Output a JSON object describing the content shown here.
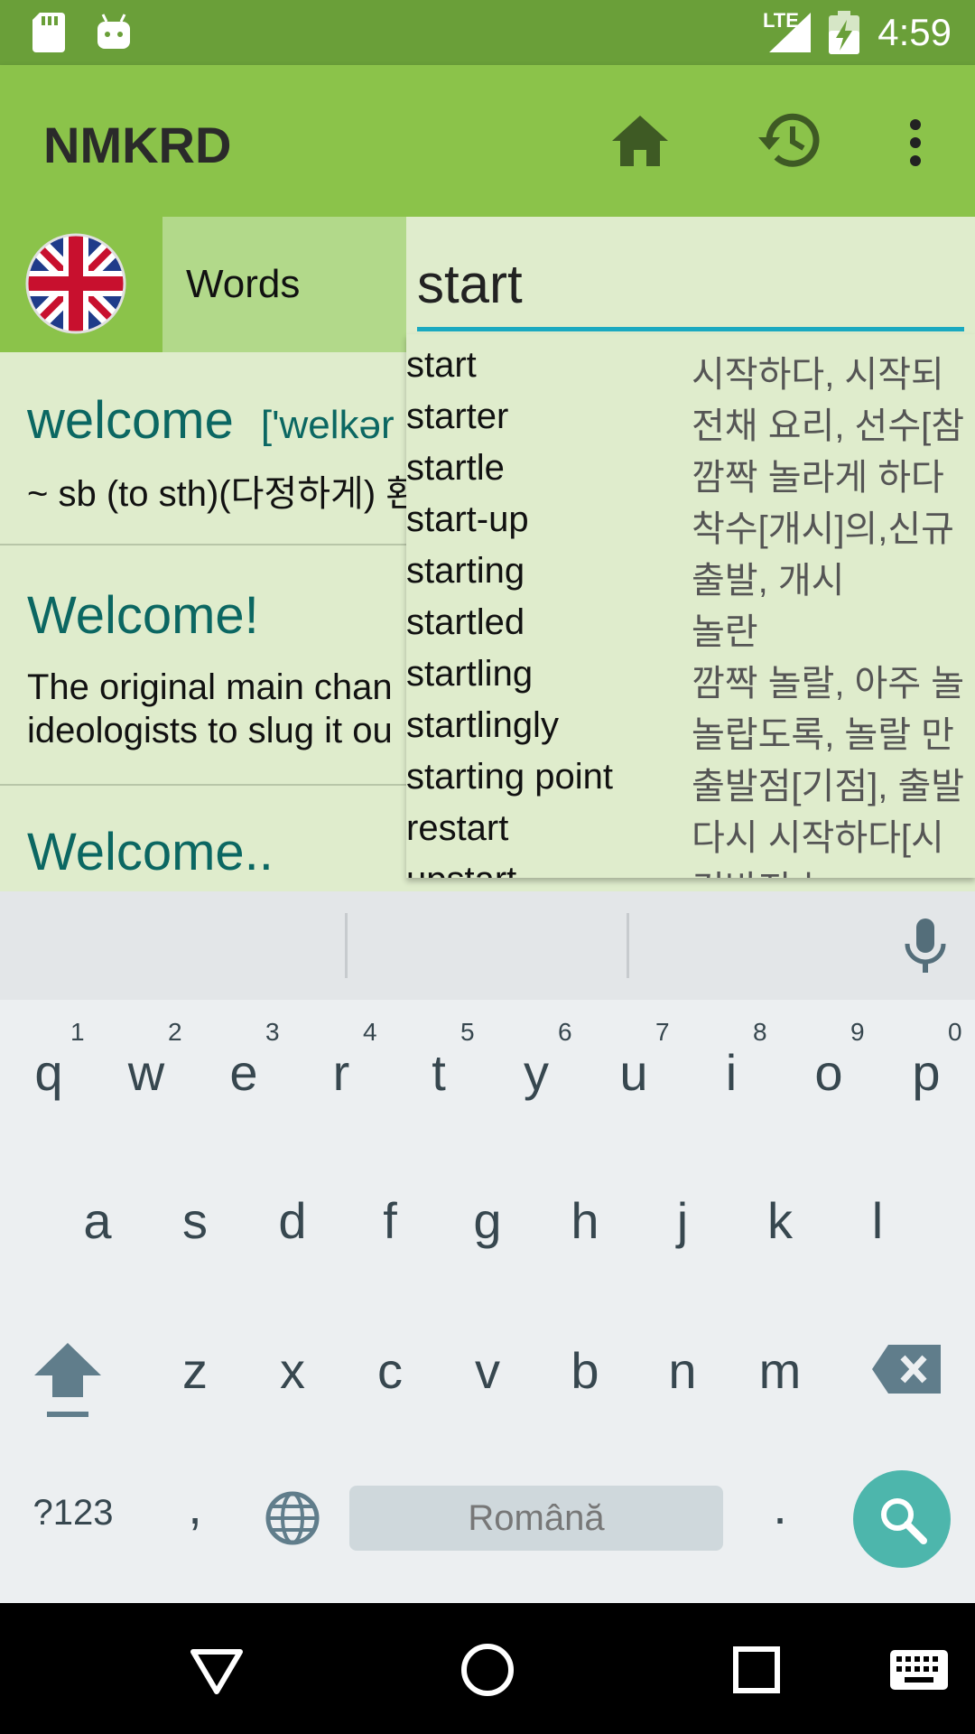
{
  "status_bar": {
    "time": "4:59",
    "network": "LTE"
  },
  "app_bar": {
    "title": "NMKRD",
    "icons": [
      "home-icon",
      "history-icon",
      "more-vert-icon"
    ]
  },
  "language": {
    "flag": "uk-flag",
    "mode_label": "Words"
  },
  "search": {
    "query": "start"
  },
  "results": [
    {
      "headword": "welcome",
      "pronunciation": "['welkər",
      "snippet": "~ sb (to sth)(다정하게) 환"
    },
    {
      "headword": "Welcome!",
      "snippet": "The original main chan",
      "snippet2": "ideologists to slug it ou"
    },
    {
      "headword": "Welcome..",
      "snippet": ""
    }
  ],
  "suggestions": [
    {
      "word": "start",
      "translation": "시작하다, 시작되"
    },
    {
      "word": "starter",
      "translation": "전채 요리, 선수[참"
    },
    {
      "word": "startle",
      "translation": "깜짝 놀라게 하다"
    },
    {
      "word": "start-up",
      "translation": "착수[개시]의,신규"
    },
    {
      "word": "starting",
      "translation": "출발, 개시"
    },
    {
      "word": "startled",
      "translation": "놀란"
    },
    {
      "word": "startling",
      "translation": "깜짝 놀랄, 아주 놀"
    },
    {
      "word": "startlingly",
      "translation": "놀랍도록, 놀랄 만"
    },
    {
      "word": "starting point",
      "translation": "출발점[기점], 출발"
    },
    {
      "word": "restart",
      "translation": "다시 시작하다[시"
    },
    {
      "word": "upstart",
      "translation": "건방진 놈"
    }
  ],
  "keyboard": {
    "row1": [
      "q",
      "w",
      "e",
      "r",
      "t",
      "y",
      "u",
      "i",
      "o",
      "p"
    ],
    "row1_hints": [
      "1",
      "2",
      "3",
      "4",
      "5",
      "6",
      "7",
      "8",
      "9",
      "0"
    ],
    "row2": [
      "a",
      "s",
      "d",
      "f",
      "g",
      "h",
      "j",
      "k",
      "l"
    ],
    "row3": [
      "z",
      "x",
      "c",
      "v",
      "b",
      "n",
      "m"
    ],
    "symbols_key": "?123",
    "comma": ",",
    "period": ".",
    "space_label": "Română"
  }
}
